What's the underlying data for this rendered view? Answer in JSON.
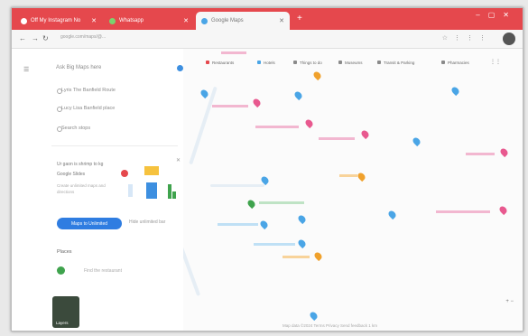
{
  "colors": {
    "accent": "#2f7de1",
    "tabstrip": "#e5484d",
    "pin_blue": "#4aa5e6",
    "pin_pink": "#e8598f",
    "pin_orange": "#f0a12c",
    "pin_green": "#3fa34d"
  },
  "tabs": [
    {
      "label": "Off My Instagram No",
      "active": false
    },
    {
      "label": "Whatsapp",
      "active": false
    },
    {
      "label": "Google Maps",
      "active": true
    }
  ],
  "toolbar": {
    "url": "google.com/maps/@...",
    "profile": "avatar"
  },
  "panel": {
    "search_placeholder": "Ask Big Maps here",
    "directions": [
      "Lyris The Banfield Route",
      "Lucy Lisa Banfield place",
      "Search stops"
    ],
    "saved_title": "Ur gaon is shrimp to kg",
    "saved_sub": "Google Slides",
    "saved_desc": "Create unlimited maps and directions",
    "primary_button": "Maps to Unlimited",
    "secondary_button": "Hide unlimited bar",
    "places_title": "Places",
    "place_text": "Find the restaurant"
  },
  "chips": [
    "Restaurants",
    "Hotels",
    "Things to do",
    "Museums",
    "Transit & Parking",
    "Pharmacies"
  ],
  "map": {
    "zoom_controls": "+ −",
    "attribution": "Map data ©2024  Terms  Privacy  Send feedback  1 km"
  },
  "thumb_label": "Layers"
}
